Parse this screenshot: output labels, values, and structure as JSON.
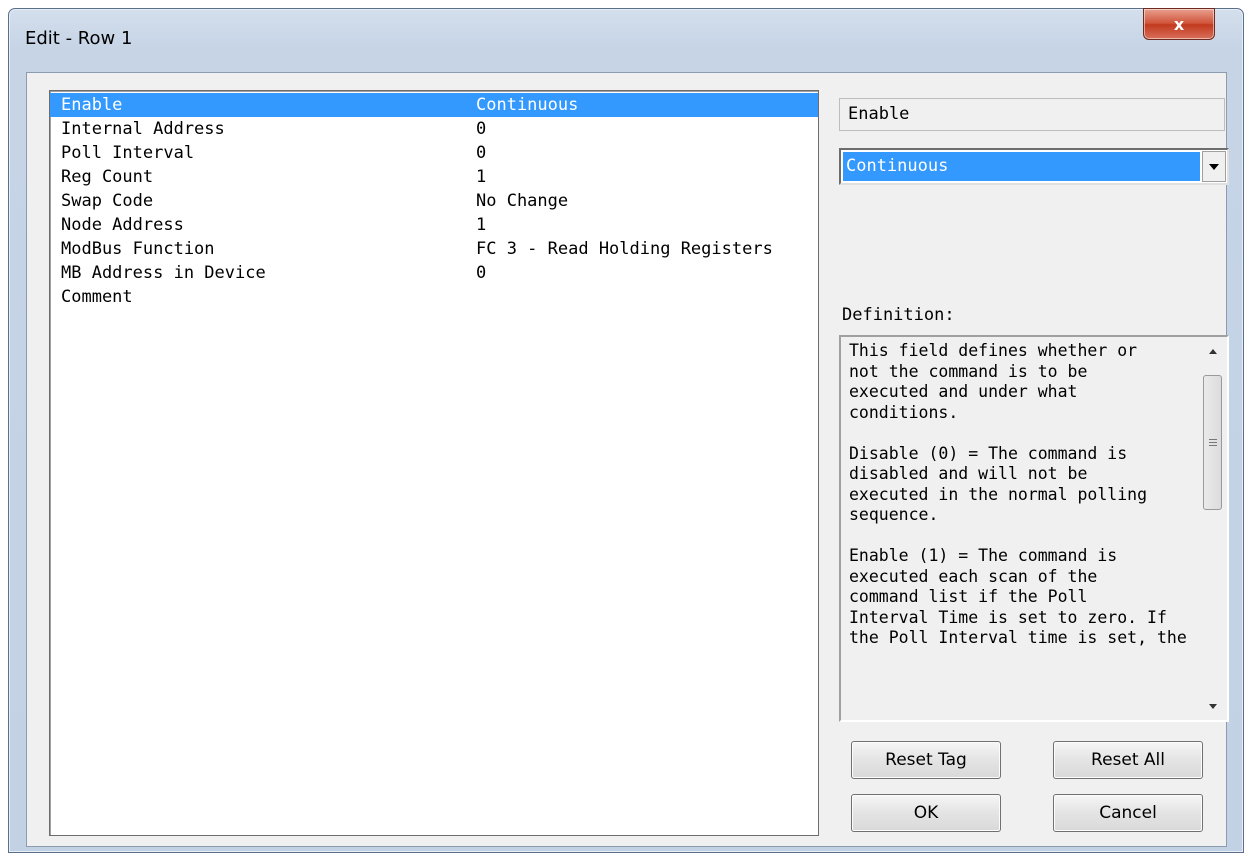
{
  "window": {
    "title": "Edit - Row 1",
    "close_glyph": "x"
  },
  "properties": [
    {
      "name": "Enable",
      "value": "Continuous",
      "selected": true
    },
    {
      "name": "Internal Address",
      "value": "0"
    },
    {
      "name": "Poll Interval",
      "value": "0"
    },
    {
      "name": "Reg Count",
      "value": "1"
    },
    {
      "name": "Swap Code",
      "value": "No Change"
    },
    {
      "name": "Node Address",
      "value": "1"
    },
    {
      "name": "ModBus Function",
      "value": "FC 3 - Read Holding Registers"
    },
    {
      "name": "MB Address in Device",
      "value": "0"
    },
    {
      "name": "Comment",
      "value": ""
    }
  ],
  "editor": {
    "field_name": "Enable",
    "selected_value": "Continuous",
    "definition_label": "Definition:",
    "definition_text": "This field defines whether or\nnot the command is to be\nexecuted and under what\nconditions.\n\nDisable (0) = The command is\ndisabled and will not be\nexecuted in the normal polling\nsequence.\n\nEnable (1) = The command is\nexecuted each scan of the\ncommand list if the Poll\nInterval Time is set to zero. If\nthe Poll Interval time is set, the"
  },
  "buttons": {
    "reset_tag": "Reset Tag",
    "reset_all": "Reset All",
    "ok": "OK",
    "cancel": "Cancel"
  }
}
